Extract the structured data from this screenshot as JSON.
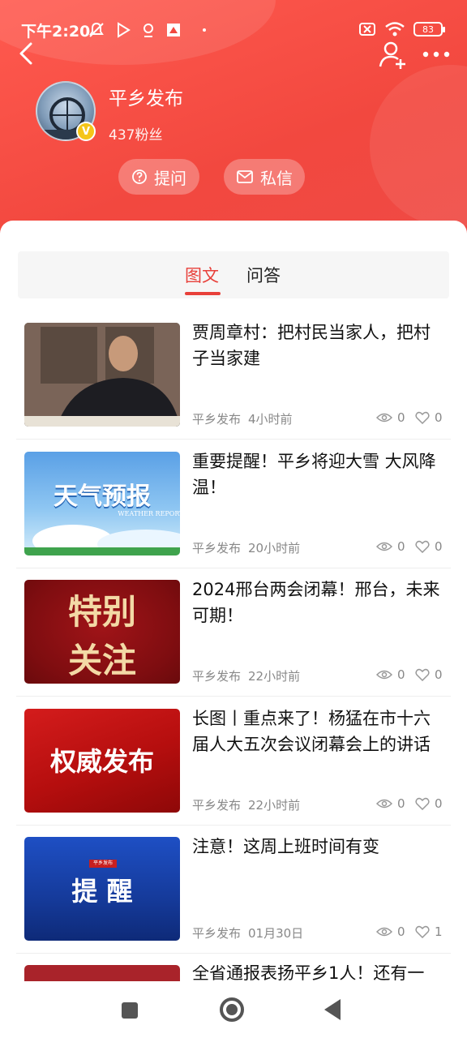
{
  "status": {
    "time": "下午2:20",
    "battery": "83"
  },
  "profile": {
    "name": "平乡发布",
    "fans": "437粉丝",
    "badge": "V"
  },
  "actions": {
    "ask": "提问",
    "message": "私信"
  },
  "tabs": [
    {
      "label": "图文",
      "active": true
    },
    {
      "label": "问答",
      "active": false
    }
  ],
  "articles": [
    {
      "title": "贾周章村：把村民当家人，把村子当家建",
      "source": "平乡发布",
      "time": "4小时前",
      "views": "0",
      "likes": "0",
      "thumb_text": ""
    },
    {
      "title": "重要提醒！平乡将迎大雪 大风降温！",
      "source": "平乡发布",
      "time": "20小时前",
      "views": "0",
      "likes": "0",
      "thumb_text": "天气预报",
      "thumb_sub": "WEATHER REPORT"
    },
    {
      "title": "2024邢台两会闭幕！邢台，未来可期！",
      "source": "平乡发布",
      "time": "22小时前",
      "views": "0",
      "likes": "0",
      "thumb_text_1": "特别",
      "thumb_text_2": "关注"
    },
    {
      "title": "长图丨重点来了！杨猛在市十六届人大五次会议闭幕会上的讲话",
      "source": "平乡发布",
      "time": "22小时前",
      "views": "0",
      "likes": "0",
      "thumb_text": "权威发布"
    },
    {
      "title": "注意！这周上班时间有变",
      "source": "平乡发布",
      "time": "01月30日",
      "views": "0",
      "likes": "1",
      "thumb_text": "提 醒",
      "thumb_tag": "平乡发布"
    },
    {
      "title": "全省通报表扬平乡1人！还有一",
      "source": "",
      "time": "",
      "views": "",
      "likes": ""
    }
  ],
  "colors": {
    "accent": "#e8403a",
    "header": "#f2483f"
  }
}
